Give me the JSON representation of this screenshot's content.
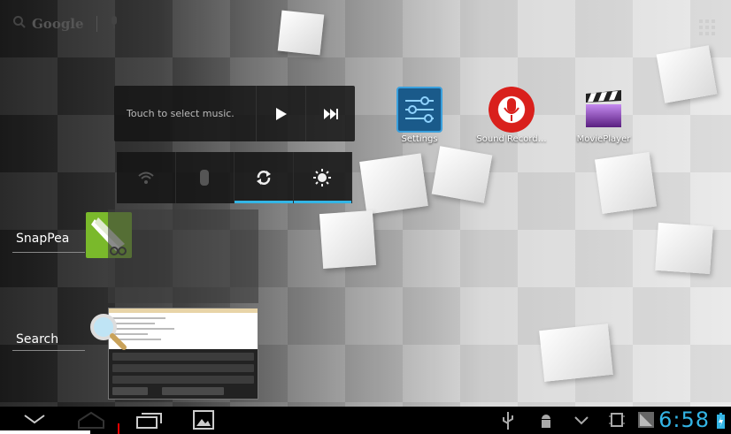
{
  "search": {
    "logo": "Google"
  },
  "music_widget": {
    "label": "Touch to select music."
  },
  "apps": [
    {
      "label": "Settings",
      "icon": "settings-sliders-icon",
      "color": "#1f6fa8"
    },
    {
      "label": "Sound Record…",
      "icon": "microphone-icon",
      "color": "#d9201c"
    },
    {
      "label": "MoviePlayer",
      "icon": "clapperboard-icon",
      "color": "#8a3fb5"
    }
  ],
  "side_labels": {
    "snappea": "SnapPea",
    "search": "Search"
  },
  "status": {
    "time": "6:58",
    "accent": "#33b5e5"
  }
}
